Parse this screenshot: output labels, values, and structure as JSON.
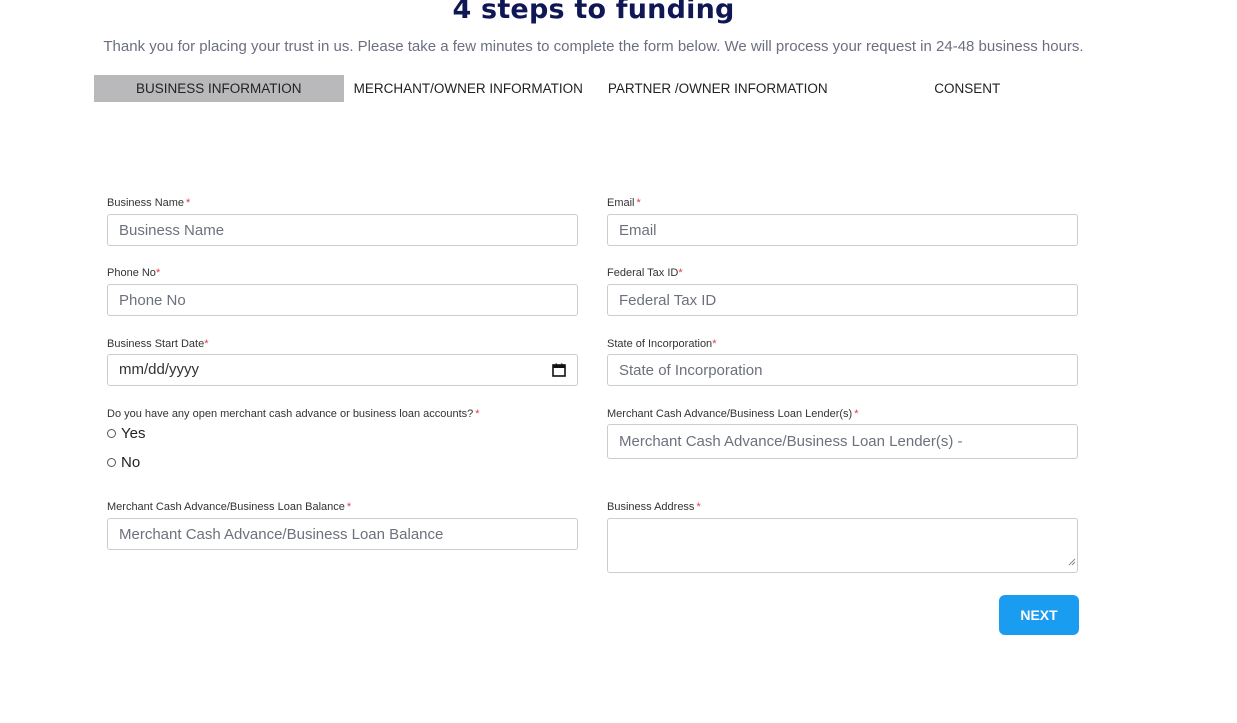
{
  "header": {
    "title": "4 steps to funding",
    "subtitle": "Thank you for placing your trust in us. Please take a few minutes to complete the form below. We will process your request in 24-48 business hours."
  },
  "tabs": [
    {
      "label": "BUSINESS INFORMATION",
      "active": true
    },
    {
      "label": "MERCHANT/OWNER INFORMATION",
      "active": false
    },
    {
      "label": "PARTNER /OWNER INFORMATION",
      "active": false
    },
    {
      "label": "CONSENT",
      "active": false
    }
  ],
  "form": {
    "business_name": {
      "label": "Business Name",
      "required_mark": "*",
      "placeholder": "Business Name"
    },
    "email": {
      "label": "Email",
      "required_mark": "*",
      "placeholder": "Email"
    },
    "phone": {
      "label": "Phone No",
      "required_mark": "*",
      "placeholder": "Phone No"
    },
    "federal_tax_id": {
      "label": "Federal Tax ID",
      "required_mark": "*",
      "placeholder": "Federal Tax ID"
    },
    "start_date": {
      "label": "Business Start Date",
      "required_mark": "*",
      "placeholder": "mm/dd/yyyy"
    },
    "state_incorporation": {
      "label": "State of Incorporation",
      "required_mark": "*",
      "placeholder": "State of Incorporation"
    },
    "open_accounts": {
      "label": "Do you have any open merchant cash advance or business loan accounts?",
      "required_mark": "*",
      "options": [
        "Yes",
        "No"
      ]
    },
    "lender": {
      "label": "Merchant Cash Advance/Business Loan Lender(s)",
      "required_mark": "*",
      "placeholder": "Merchant Cash Advance/Business Loan Lender(s) -"
    },
    "loan_balance": {
      "label": "Merchant Cash Advance/Business Loan Balance",
      "required_mark": "*",
      "placeholder": "Merchant Cash Advance/Business Loan Balance"
    },
    "business_address": {
      "label": "Business Address",
      "required_mark": "*"
    }
  },
  "actions": {
    "next_label": "NEXT"
  },
  "colors": {
    "accent": "#1a9cf0",
    "title": "#0f1854",
    "active_tab": "#b9b9bb",
    "required": "#e0394b"
  },
  "icons": {
    "date_picker": "calendar-icon"
  }
}
